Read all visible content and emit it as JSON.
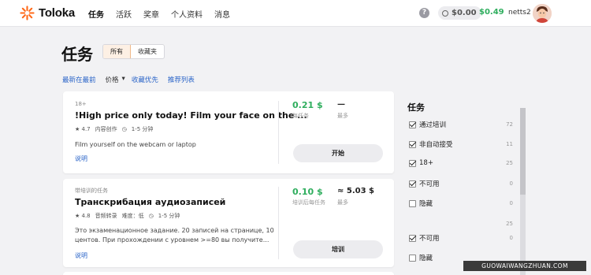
{
  "header": {
    "brand": "Toloka",
    "nav": [
      "任务",
      "活跃",
      "奖章",
      "个人资料",
      "消息"
    ],
    "help_label": "?",
    "balance_pending": "$0.00",
    "balance_available": "$0.49",
    "username": "netts2"
  },
  "page": {
    "title": "任务",
    "view_toggle": [
      "所有",
      "收藏夹"
    ],
    "sort": {
      "newest": "最新在最前",
      "price": "价格",
      "price_arrow": "▾",
      "favorites_first": "收藏优先",
      "recommended": "推荐列表"
    }
  },
  "tasks": [
    {
      "pre": "18+",
      "title": "!High price only today! Film your face on the ...",
      "rating": "★ 4.7",
      "requester": "内容创作",
      "duration": "1-5 分钟",
      "description": "Film yourself on the webcam or laptop",
      "link": "说明",
      "price": "0.21 $",
      "price_label": "每任务",
      "max": "—",
      "max_label": "最多",
      "button": "开始"
    },
    {
      "pre": "带培训的任务",
      "title": "Транскрибация аудиозаписей",
      "rating": "★ 4.8",
      "requester": "音频转录",
      "extra": "难度：低",
      "duration": "1-5 分钟",
      "description": "Это экзаменационное задание. 20 записей на странице, 10 центов. При прохождении с уровнем >=80 вы получите...",
      "link": "说明",
      "price": "0.10 $",
      "price_label": "培训后每任务",
      "max": "≈ 5.03 $",
      "max_label": "最多",
      "button": "培训"
    }
  ],
  "filters": {
    "title": "任务",
    "items": [
      {
        "label": "通过培训",
        "checked": true,
        "count": "72"
      },
      {
        "label": "非自动接受",
        "checked": true,
        "count": "11"
      },
      {
        "label": "18+",
        "checked": true,
        "count": "25"
      },
      {
        "label": "不可用",
        "checked": true,
        "count": "0"
      },
      {
        "label": "隐藏",
        "checked": false,
        "count": "0"
      },
      {
        "label": "",
        "checked": null,
        "count": "25"
      },
      {
        "label": "不可用",
        "checked": true,
        "count": "0"
      },
      {
        "label": "隐藏",
        "checked": false,
        "count": ""
      }
    ]
  },
  "watermark": "GUOWAIWANGZHUAN.COM",
  "colors": {
    "accent_green": "#2fae5e",
    "link_blue": "#2a64c8",
    "logo_orange": "#ff6a1a"
  }
}
